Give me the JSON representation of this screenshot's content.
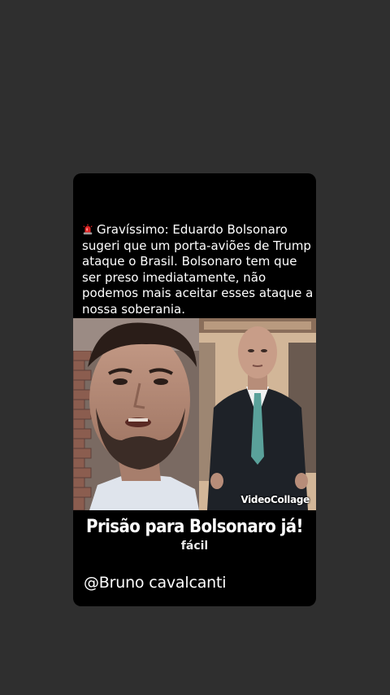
{
  "story": {
    "siren_icon": "police-siren-emoji",
    "caption": "Gravíssimo: Eduardo Bolsonaro sugeri que um porta-aviões de Trump ataque o Brasil. Bolsonaro tem que ser preso imediatamente, não podemos mais aceitar esses ataque a nossa soberania.",
    "watermark": "VideoCollage",
    "headline": "Prisão para Bolsonaro já!",
    "ghost_line_bottom": "fácil",
    "author": "@Bruno cavalcanti"
  },
  "colors": {
    "background": "#2f2f2f",
    "card": "#000000",
    "text": "#ffffff"
  }
}
